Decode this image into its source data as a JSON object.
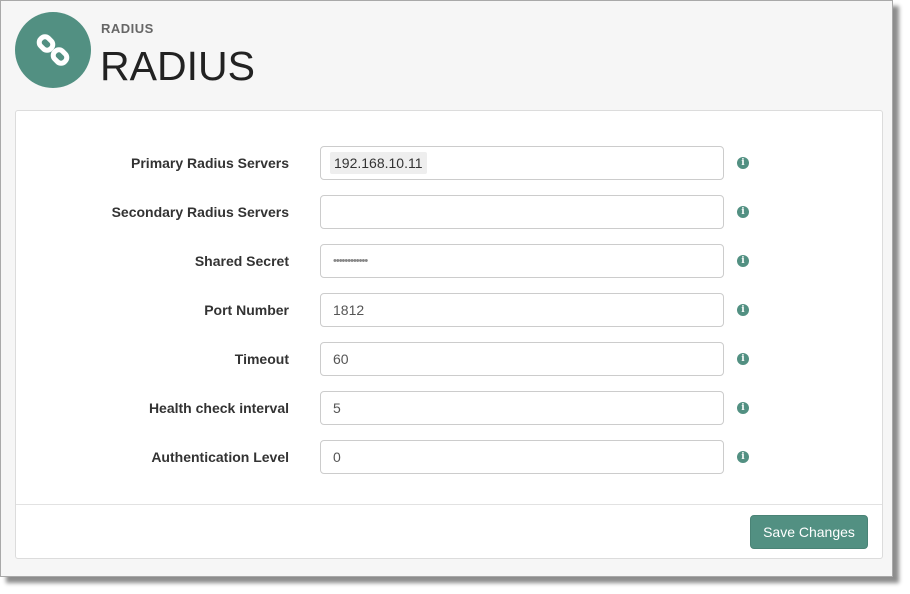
{
  "header": {
    "icon": "link-icon",
    "subtitle": "RADIUS",
    "title": "RADIUS"
  },
  "colors": {
    "accent": "#529082"
  },
  "form": {
    "fields": [
      {
        "label": "Primary Radius Servers",
        "value": "192.168.10.11",
        "type": "tag"
      },
      {
        "label": "Secondary Radius Servers",
        "value": "",
        "type": "text"
      },
      {
        "label": "Shared Secret",
        "value": "••••••••••••",
        "type": "password"
      },
      {
        "label": "Port Number",
        "value": "1812",
        "type": "text"
      },
      {
        "label": "Timeout",
        "value": "60",
        "type": "text"
      },
      {
        "label": "Health check interval",
        "value": "5",
        "type": "text"
      },
      {
        "label": "Authentication Level",
        "value": "0",
        "type": "text"
      }
    ],
    "info_icon": "i",
    "save_label": "Save Changes"
  }
}
